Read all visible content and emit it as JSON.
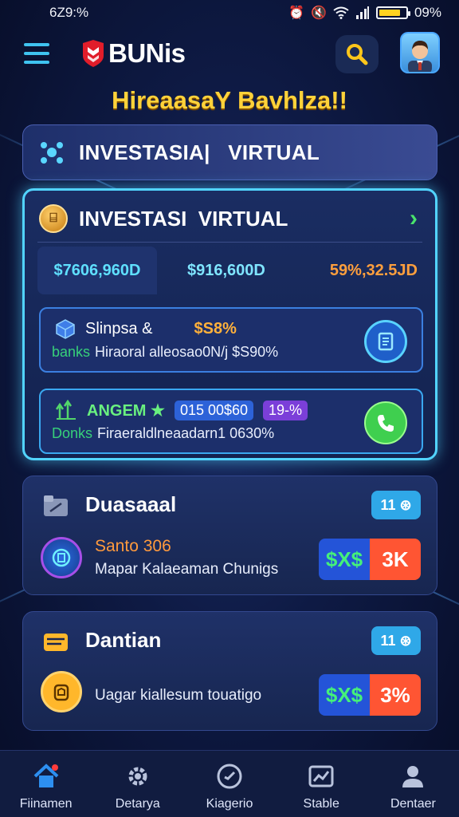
{
  "status_bar": {
    "time": "6Z9:%",
    "battery_text": "09%",
    "battery_level": 0.8
  },
  "header": {
    "brand_name": "BUNis"
  },
  "greeting": "HireaasaY Bavhlza!!",
  "banner": {
    "title": "INVESTASIA|   VIRTUAL"
  },
  "invest_card": {
    "title": "INVESTASI  VIRTUAL",
    "stats": [
      "$7606,960D",
      "$916,600D",
      "59%,32.5JD"
    ],
    "items": [
      {
        "name": "Slinpsa &",
        "percent": "$S8%",
        "tag": "banks",
        "desc": "Hiraoral alleosao0N/j $S90%"
      },
      {
        "name": "ANGEM ★",
        "chip_amount": "015 00$60",
        "chip_pct": "19-%",
        "tag": "Donks",
        "desc": "Firaeraldlneaadarn1 0630%"
      }
    ]
  },
  "cards": [
    {
      "title": "Duasaaal",
      "badge": "11 ⊛",
      "sub_title": "Santo 306",
      "desc": "Mapar Kalaeaman Chunigs",
      "pill_left": "$X$",
      "pill_right": "3K"
    },
    {
      "title": "Dantian",
      "badge": "11 ⊛",
      "sub_title": "",
      "desc": "Uagar kiallesum touatigo",
      "pill_left": "$X$",
      "pill_right": "3%"
    }
  ],
  "nav": [
    {
      "label": "Fiinamen",
      "icon": "home-icon"
    },
    {
      "label": "Detarya",
      "icon": "gear-icon"
    },
    {
      "label": "Kiagerio",
      "icon": "compass-icon"
    },
    {
      "label": "Stable",
      "icon": "chart-icon"
    },
    {
      "label": "Dentaer",
      "icon": "user-icon"
    }
  ],
  "colors": {
    "accent": "#52d4ff",
    "greeting": "#ffd23a",
    "positive": "#45f07a",
    "negative": "#ff5533"
  }
}
